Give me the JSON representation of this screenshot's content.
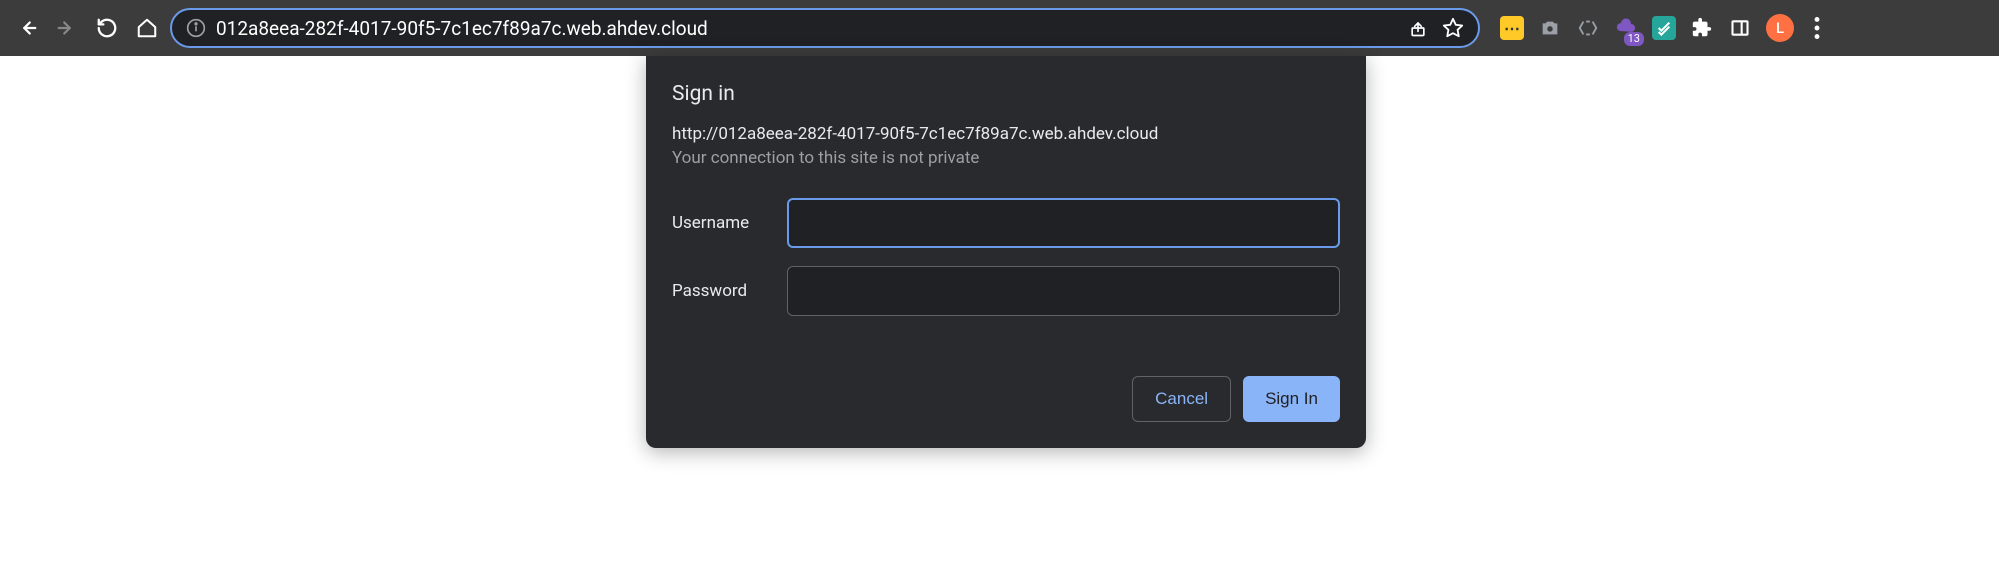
{
  "toolbar": {
    "address": "012a8eea-282f-4017-90f5-7c1ec7f89a7c.web.ahdev.cloud",
    "extension_badge": "13",
    "profile_letter": "L"
  },
  "dialog": {
    "title": "Sign in",
    "url": "http://012a8eea-282f-4017-90f5-7c1ec7f89a7c.web.ahdev.cloud",
    "warning": "Your connection to this site is not private",
    "username_label": "Username",
    "username_value": "",
    "password_label": "Password",
    "password_value": "",
    "cancel_label": "Cancel",
    "signin_label": "Sign In"
  }
}
